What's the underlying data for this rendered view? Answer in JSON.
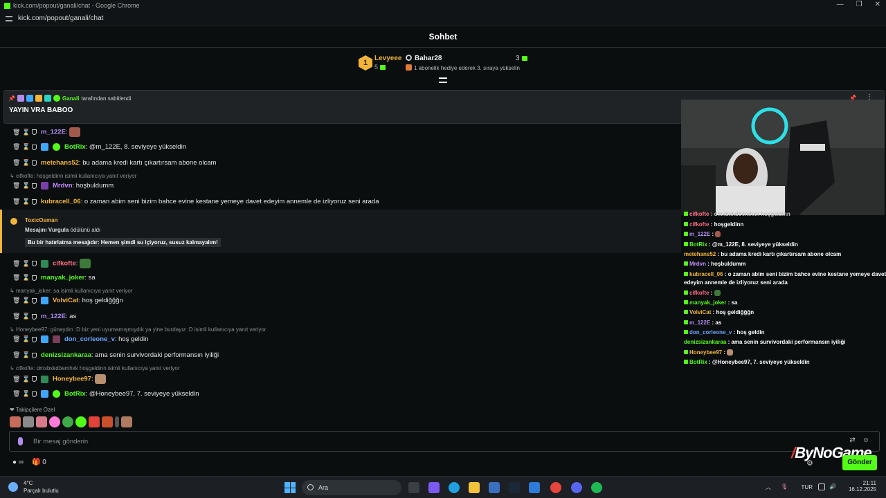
{
  "window": {
    "title": "kick.com/popout/ganali/chat - Google Chrome",
    "url": "kick.com/popout/ganali/chat"
  },
  "header": {
    "title": "Sohbet"
  },
  "leaderboard": {
    "rank": "1",
    "first_name": "Levyeee",
    "first_count": "5",
    "second_name": "Bahar28",
    "second_count": "3",
    "hint": "1 abonelik hediye ederek 3. sıraya yükselin"
  },
  "pinned": {
    "pinner": "Ganali",
    "pinned_by_text": "tarafından sabitlendi",
    "message": "YAYIN VRA BABOO"
  },
  "messages": [
    {
      "user": "m_122E",
      "text": "",
      "color": "#b48cf0"
    },
    {
      "user": "BotRix",
      "text": "@m_122E, 8. seviyeye yükseldin",
      "color": "#53fc18"
    },
    {
      "user": "metehans52",
      "text": "bu adama kredi kartı çıkartırsam abone olcam",
      "color": "#f2b53a"
    },
    {
      "reply": "cifkofte: hoşgeldinn isimli kullanıcıya yanıt veriyor"
    },
    {
      "user": "Mrdvn",
      "text": "hoşbuldumm",
      "color": "#c48bff"
    },
    {
      "user": "kubracell_06",
      "text": "o zaman abim seni bizim bahce evine kestane yemeye davet edeyim annemle de izliyoruz seni arada",
      "color": "#f2b53a"
    },
    {
      "user": "cifkofte",
      "text": "",
      "color": "#ff6b81"
    },
    {
      "user": "manyak_joker",
      "text": "sa",
      "color": "#53fc18"
    },
    {
      "reply": "manyak_joker: sa isimli kullanıcıya yanıt veriyor"
    },
    {
      "user": "VolviCat",
      "text": "hoş geldiğğğn",
      "color": "#f2b53a"
    },
    {
      "user": "m_122E",
      "text": "as",
      "color": "#b48cf0"
    },
    {
      "reply": "Honeybee97: günaydın :D biz yeni uyumamışmıydık ya yine burdayız :D isimli kullanıcıya yanıt veriyor"
    },
    {
      "user": "don_corleone_v",
      "text": "hoş geldin",
      "color": "#6aa8ff"
    },
    {
      "user": "denizsizankaraa",
      "text": "ama senin survivordaki performansın iyiliği",
      "color": "#53fc18"
    },
    {
      "reply": "cifkofte: dmxbxkdöemhxk hoşgeldinn isimli kullanıcıya yanıt veriyor"
    },
    {
      "user": "Honeybee97",
      "text": "",
      "color": "#f2b53a"
    },
    {
      "user": "BotRix",
      "text": "@Honeybee97, 7. seviyeye yükseldin",
      "color": "#53fc18"
    }
  ],
  "highlight": {
    "user": "ToxicOsman",
    "reward": "Mesajını Vurgula",
    "reward_suffix": "ödülünü aldı",
    "message": "Bu bir hatırlatma mesajıdır: Hemen şimdi su içiyoruz, susuz kalmayalım!"
  },
  "followers_label": "Takipçilere Özel",
  "input": {
    "placeholder": "Bir mesaj gönderin"
  },
  "bottom": {
    "points_value": "∞",
    "count": "0",
    "send_label": "Gönder"
  },
  "watermark": "ByNoGame",
  "overlay_chat": [
    {
      "user": "cifkofte",
      "text": "dmxbxkdöemhxk hoşgeldinn"
    },
    {
      "user": "cifkofte",
      "text": "hoşgeldinn"
    },
    {
      "user": "m_122E",
      "text": ""
    },
    {
      "user": "BotRix",
      "text": "@m_122E, 8. seviyeye yükseldin"
    },
    {
      "user": "metehans52",
      "text": "bu adama kredi kartı çıkartırsam abone olcam"
    },
    {
      "user": "Mrdvn",
      "text": "hoşbuldumm"
    },
    {
      "user": "kubracell_06",
      "text": "o zaman abim seni bizim bahce evine kestane yemeye davet"
    },
    {
      "user": "",
      "text": "edeyim annemle de izliyoruz seni arada"
    },
    {
      "user": "cifkofte",
      "text": ""
    },
    {
      "user": "manyak_joker",
      "text": "sa"
    },
    {
      "user": "VolviCat",
      "text": "hoş geldiğğğn"
    },
    {
      "user": "m_122E",
      "text": "as"
    },
    {
      "user": "don_corleone_v",
      "text": "hoş geldin"
    },
    {
      "user": "denizsizankaraa",
      "text": "ama senin survivordaki performansın iyiliği"
    },
    {
      "user": "Honeybee97",
      "text": ""
    },
    {
      "user": "BotRix",
      "text": "@Honeybee97, 7. seviyeye yükseldin"
    }
  ],
  "taskbar": {
    "temp": "4°C",
    "weather": "Parçalı bulutlu",
    "search": "Ara",
    "lang": "TUR",
    "time": "21:11",
    "date": "16.12.2025"
  },
  "colors": {
    "kick_green": "#53fc18",
    "gold": "#f2b53a",
    "bg": "#0b0e0f"
  }
}
